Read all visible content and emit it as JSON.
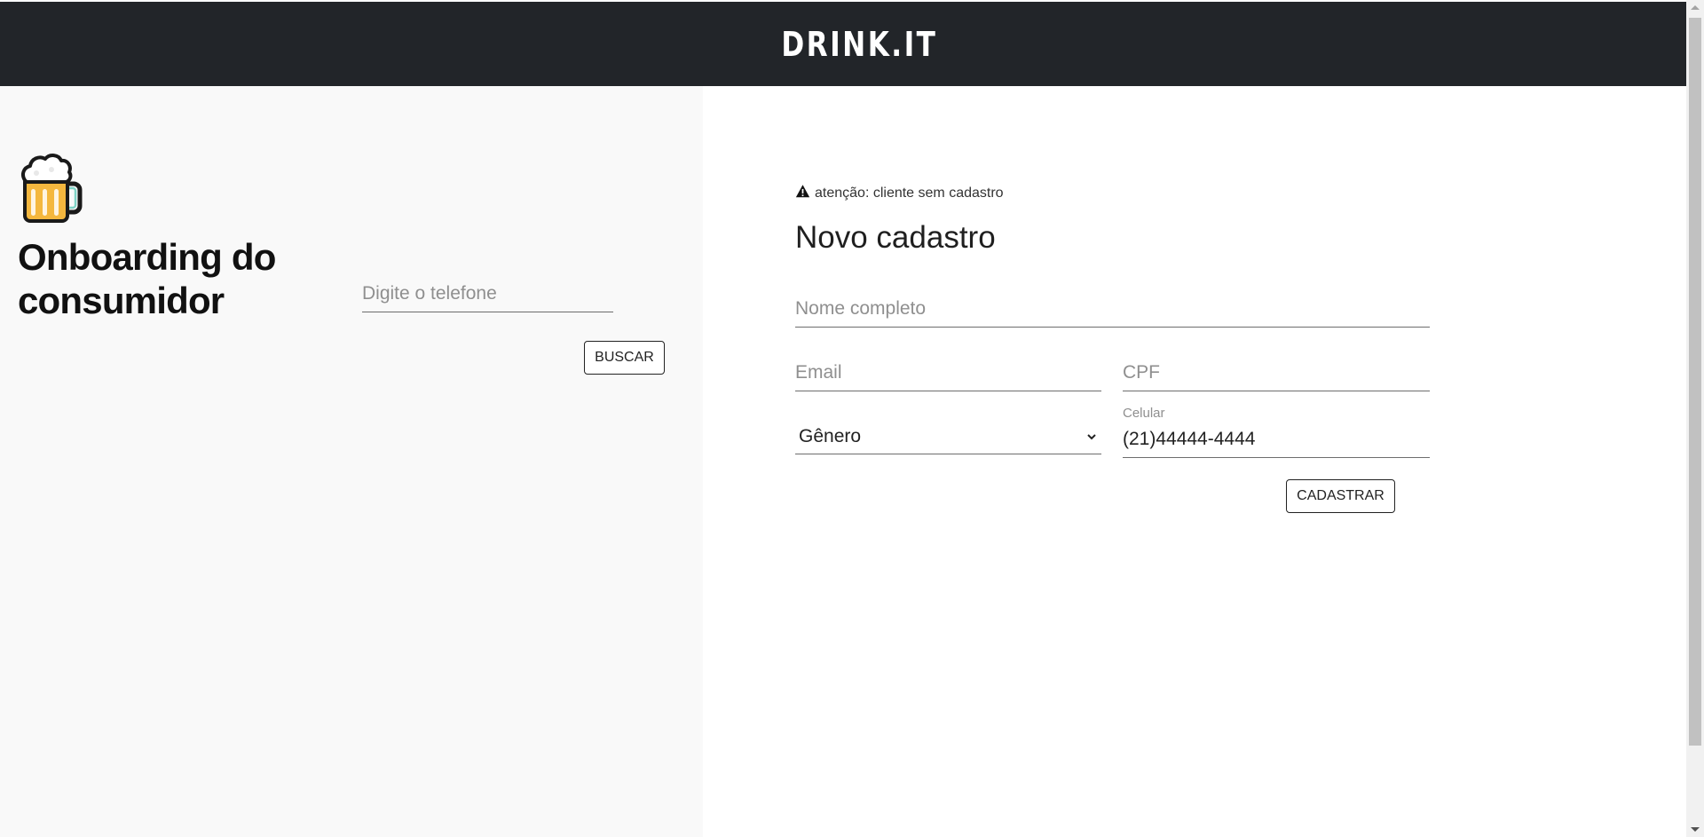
{
  "header": {
    "logo_text": "DRINK.IT"
  },
  "left_panel": {
    "icon": "beer-mug-icon",
    "title": "Onboarding do consumidor",
    "search": {
      "placeholder": "Digite o telefone",
      "value": ""
    },
    "search_button_label": "BUSCAR"
  },
  "form": {
    "warning_icon": "warning-triangle-icon",
    "warning_text": "atenção: cliente sem cadastro",
    "title": "Novo cadastro",
    "fields": {
      "nome": {
        "placeholder": "Nome completo",
        "value": ""
      },
      "email": {
        "placeholder": "Email",
        "value": ""
      },
      "cpf": {
        "placeholder": "CPF",
        "value": ""
      },
      "genero": {
        "selected": "Gênero"
      },
      "celular": {
        "label": "Celular",
        "value": "(21)44444-4444"
      }
    },
    "submit_label": "CADASTRAR"
  },
  "colors": {
    "header_bg": "#222529",
    "left_panel_bg": "#f9f9f9",
    "form_bg": "#ffffff"
  }
}
